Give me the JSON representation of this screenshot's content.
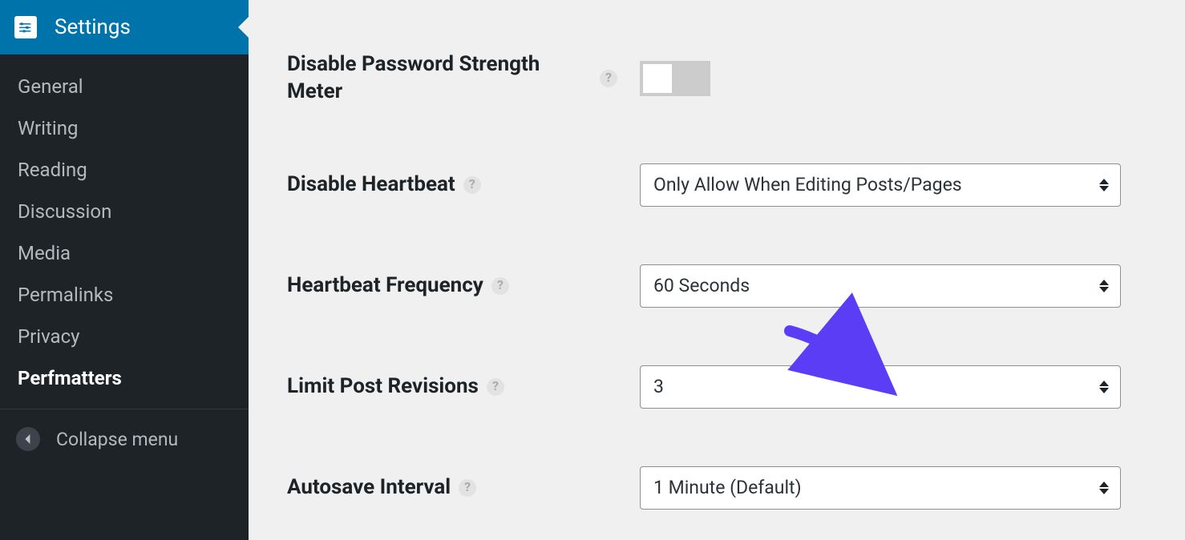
{
  "sidebar": {
    "top_label": "Settings",
    "items": [
      {
        "label": "General",
        "active": false
      },
      {
        "label": "Writing",
        "active": false
      },
      {
        "label": "Reading",
        "active": false
      },
      {
        "label": "Discussion",
        "active": false
      },
      {
        "label": "Media",
        "active": false
      },
      {
        "label": "Permalinks",
        "active": false
      },
      {
        "label": "Privacy",
        "active": false
      },
      {
        "label": "Perfmatters",
        "active": true
      }
    ],
    "collapse_label": "Collapse menu"
  },
  "settings": {
    "disable_pw_meter": {
      "label": "Disable Password Strength Meter",
      "value": false
    },
    "disable_heartbeat": {
      "label": "Disable Heartbeat",
      "value": "Only Allow When Editing Posts/Pages"
    },
    "heartbeat_freq": {
      "label": "Heartbeat Frequency",
      "value": "60 Seconds"
    },
    "limit_revisions": {
      "label": "Limit Post Revisions",
      "value": "3"
    },
    "autosave_interval": {
      "label": "Autosave Interval",
      "value": "1 Minute (Default)"
    }
  },
  "help_glyph": "?"
}
